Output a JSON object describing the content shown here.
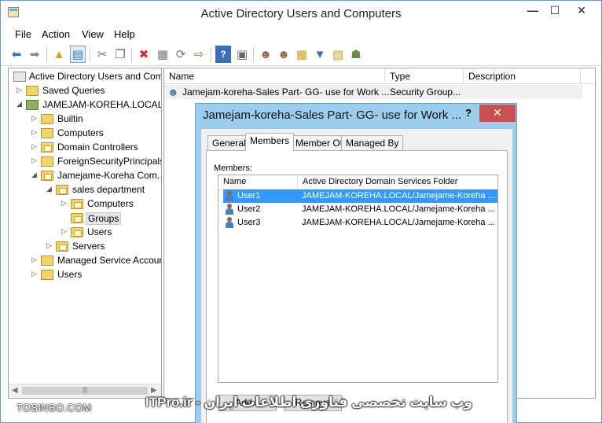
{
  "window": {
    "title": "Active Directory Users and Computers",
    "controls": {
      "minimize": "—",
      "maximize": "☐",
      "close": "✕"
    }
  },
  "menu": [
    "File",
    "Action",
    "View",
    "Help"
  ],
  "toolbar": {
    "icons": [
      "back-arrow-icon",
      "forward-arrow-icon",
      "up-folder-icon",
      "show-pane-icon",
      "cut-icon",
      "copy-icon",
      "delete-icon",
      "properties-icon",
      "refresh-icon",
      "export-icon",
      "help-icon",
      "console-icon",
      "new-user-icon",
      "new-group-icon",
      "new-ou-icon",
      "filter-icon",
      "add-to-group-icon",
      "delegate-icon"
    ]
  },
  "tree": {
    "root": "Active Directory Users and Com",
    "saved_queries": "Saved Queries",
    "domain": "JAMEJAM-KOREHA.LOCAL",
    "items": {
      "builtin": "Builtin",
      "computers": "Computers",
      "domain_controllers": "Domain Controllers",
      "foreign": "ForeignSecurityPrincipals",
      "jamejame": "Jamejame-Koreha Com.",
      "sales": "sales department",
      "sales_computers": "Computers",
      "groups": "Groups",
      "sales_users": "Users",
      "servers": "Servers",
      "managed": "Managed Service Accour",
      "users": "Users"
    }
  },
  "list": {
    "columns": {
      "name": "Name",
      "type": "Type",
      "description": "Description"
    },
    "rows": [
      {
        "name": "Jamejam-koreha-Sales Part- GG- use for Work ...",
        "type": "Security Group...",
        "description": ""
      }
    ]
  },
  "dialog": {
    "title": "Jamejam-koreha-Sales Part- GG- use for Work ...",
    "help": "?",
    "close": "✕",
    "tabs": {
      "general": "General",
      "members": "Members",
      "member_of": "Member Of",
      "managed_by": "Managed By"
    },
    "members_label": "Members:",
    "columns": {
      "name": "Name",
      "folder": "Active Directory Domain Services Folder"
    },
    "members": [
      {
        "name": "User1",
        "folder": "JAMEJAM-KOREHA.LOCAL/Jamejame-Koreha ..."
      },
      {
        "name": "User2",
        "folder": "JAMEJAM-KOREHA.LOCAL/Jamejame-Koreha ..."
      },
      {
        "name": "User3",
        "folder": "JAMEJAM-KOREHA.LOCAL/Jamejame-Koreha ..."
      }
    ],
    "buttons": {
      "add": "Add...",
      "remove": "Remove"
    }
  },
  "watermark": {
    "left": "TOSINSO.COM",
    "right": "وب سایت تخصصی فناوری اطلاعات ایران - ITPro.ir"
  }
}
